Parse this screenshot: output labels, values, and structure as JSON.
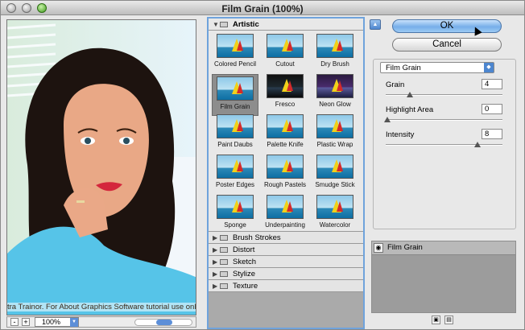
{
  "window": {
    "title": "Film Grain (100%)"
  },
  "preview": {
    "caption": "tra Trainor. For About Graphics Software tutorial use onl",
    "zoom": "100%"
  },
  "statusbar": {
    "minus": "-",
    "plus": "+"
  },
  "gallery": {
    "open_folder": "Artistic",
    "thumbnails": [
      {
        "label": "Colored Pencil"
      },
      {
        "label": "Cutout"
      },
      {
        "label": "Dry Brush"
      },
      {
        "label": "Film Grain"
      },
      {
        "label": "Fresco"
      },
      {
        "label": "Neon Glow"
      },
      {
        "label": "Paint Daubs"
      },
      {
        "label": "Palette Knife"
      },
      {
        "label": "Plastic Wrap"
      },
      {
        "label": "Poster Edges"
      },
      {
        "label": "Rough Pastels"
      },
      {
        "label": "Smudge Stick"
      },
      {
        "label": "Sponge"
      },
      {
        "label": "Underpainting"
      },
      {
        "label": "Watercolor"
      }
    ],
    "selected": "Film Grain",
    "folders": [
      {
        "label": "Brush Strokes"
      },
      {
        "label": "Distort"
      },
      {
        "label": "Sketch"
      },
      {
        "label": "Stylize"
      },
      {
        "label": "Texture"
      }
    ]
  },
  "buttons": {
    "ok": "OK",
    "cancel": "Cancel"
  },
  "settings": {
    "filter": "Film Grain",
    "params": [
      {
        "label": "Grain",
        "value": "4",
        "level": 0.2
      },
      {
        "label": "Highlight Area",
        "value": "0",
        "level": 0.0
      },
      {
        "label": "Intensity",
        "value": "8",
        "level": 0.8
      }
    ]
  },
  "layers": {
    "items": [
      {
        "label": "Film Grain"
      }
    ]
  },
  "colors": {
    "accent": "#6fa3dc",
    "button_blue": "#76aee9",
    "window_bg": "#e8e8e8"
  }
}
